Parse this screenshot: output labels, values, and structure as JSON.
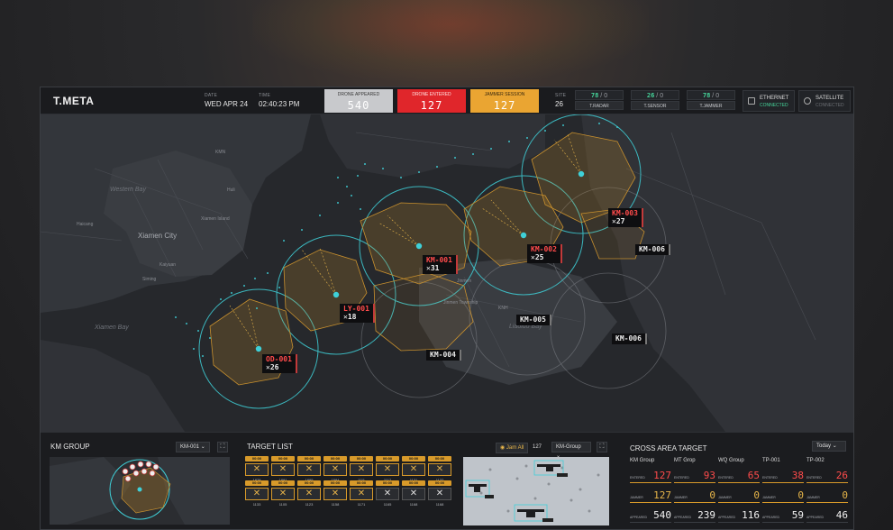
{
  "header": {
    "brand": "T.META",
    "date_label": "DATE",
    "date_value": "WED APR 24",
    "time_label": "TIME",
    "time_value": "02:40:23 PM",
    "counters": [
      {
        "label": "DRONE APPEARED",
        "value": "540",
        "bg": "#c8c9cc",
        "fg": "#ffffff"
      },
      {
        "label": "DRONE ENTERED",
        "value": "127",
        "bg": "#e0262b",
        "fg": "#ffffff"
      },
      {
        "label": "JAMMER SESSION",
        "value": "127",
        "bg": "#eaa532",
        "fg": "#ffffff"
      }
    ],
    "site_label": "SITE",
    "site_value": "26",
    "sensors": [
      {
        "count": "78",
        "zero": "0",
        "name": "T.RADAR"
      },
      {
        "count": "26",
        "zero": "0",
        "name": "T.SENSOR"
      },
      {
        "count": "78",
        "zero": "0",
        "name": "T.JAMMER"
      }
    ],
    "connections": [
      {
        "name": "ETHERNET",
        "status": "CONNECTED",
        "status_color": "#46d49a"
      },
      {
        "name": "SATELLITE",
        "status": "CONNECTED",
        "status_color": "#6b6e73"
      }
    ]
  },
  "map": {
    "places": {
      "xiamen_city": "Xiamen City",
      "huli": "Huli",
      "haicang": "Haicang",
      "siming": "Siming",
      "kmn": "KMN",
      "western_bay": "Western Bay",
      "xiamen_bay": "Xiamen Bay",
      "liaoluo_bay": "Liaoluo Bay",
      "xiamen_island": "Xiamen Island",
      "knh": "KNH",
      "jinmen": "Jinmen",
      "jinmen_township": "Jinmen Township",
      "kaiyuan": "Kaiyuan"
    },
    "targets": [
      {
        "name": "OD-001",
        "count": "✕26",
        "alert": true
      },
      {
        "name": "LY-001",
        "count": "✕18",
        "alert": true
      },
      {
        "name": "KM-001",
        "count": "✕31",
        "alert": true
      },
      {
        "name": "KM-002",
        "count": "✕25",
        "alert": true
      },
      {
        "name": "KM-003",
        "count": "✕27",
        "alert": true
      },
      {
        "name": "KM-004",
        "alert": false
      },
      {
        "name": "KM-005",
        "alert": false
      },
      {
        "name": "KM-006",
        "alert": false
      },
      {
        "name": "KM-006",
        "alert": false
      }
    ]
  },
  "bottom": {
    "km_group": {
      "title": "KM GROUP",
      "select": "KM-001",
      "chevron": "⌄",
      "expand_icon": "⛶"
    },
    "target_list": {
      "title": "TARGET LIST",
      "jam_all": "Jam All",
      "jam_count": "127",
      "group_select": "KM-Group",
      "row1_ids": [
        "1878",
        "1891",
        "1895",
        "1584",
        "1111",
        "1117",
        "1131",
        "1132"
      ],
      "row2_ids": [
        "1133",
        "1105",
        "1123",
        "1158",
        "1171",
        "1165",
        "1168",
        "1168"
      ],
      "badge": "00:00"
    },
    "cross_area": {
      "title": "CROSS AREA TARGET",
      "period": "Today",
      "labels": {
        "entered": "ENTERED",
        "jammer": "JAMMER",
        "appeared": "APPEARED"
      },
      "groups": [
        {
          "name": "KM Group",
          "entered": "127",
          "jammer": "127",
          "appeared": "540"
        },
        {
          "name": "MT Grop",
          "entered": "93",
          "jammer": "0",
          "appeared": "239"
        },
        {
          "name": "WQ Group",
          "entered": "65",
          "jammer": "0",
          "appeared": "116"
        },
        {
          "name": "TP-001",
          "entered": "38",
          "jammer": "0",
          "appeared": "59"
        },
        {
          "name": "TP-002",
          "entered": "26",
          "jammer": "0",
          "appeared": "46"
        }
      ]
    }
  },
  "colors": {
    "alert": "#ff4b4b",
    "amber": "#e8b64a",
    "teal": "#3fd0d8",
    "green": "#46d49a"
  }
}
